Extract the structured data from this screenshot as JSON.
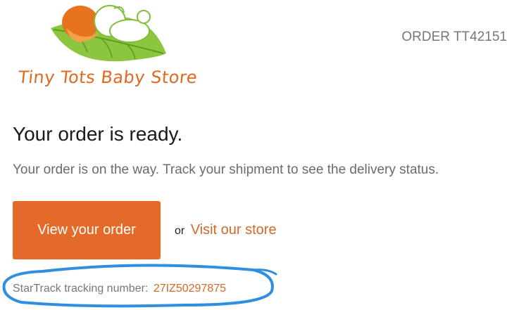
{
  "store": {
    "name": "Tiny Tots Baby Store",
    "logo_icon": "baby-on-leaf-logo"
  },
  "header": {
    "order_number": "ORDER TT42151"
  },
  "main": {
    "headline": "Your order is ready.",
    "subtext": "Your order is on the way. Track your shipment to see the delivery status.",
    "view_order_label": "View your order",
    "or_label": "or",
    "visit_store_label": "Visit our store"
  },
  "tracking": {
    "label": "StarTrack tracking number:",
    "number": "27IZ50297875"
  },
  "colors": {
    "accent": "#e46a2a",
    "link": "#d4682a",
    "leaf_green": "#8cc63f",
    "annotation_blue": "#2f8ee0"
  }
}
